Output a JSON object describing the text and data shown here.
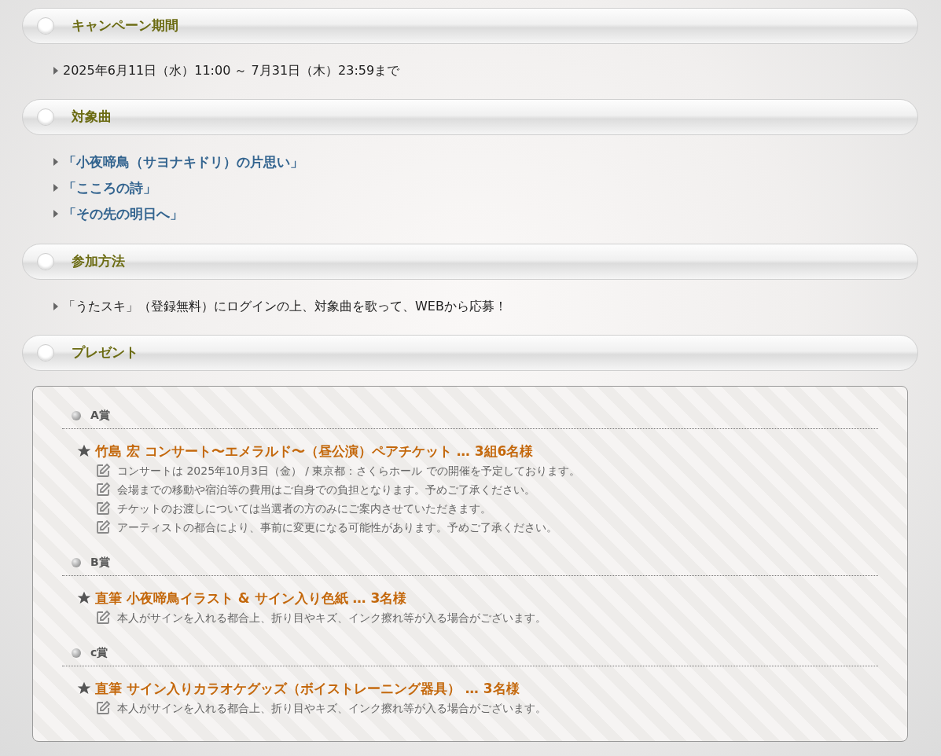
{
  "sections": [
    {
      "heading": "キャンペーン期間",
      "items": [
        {
          "kind": "text",
          "text": "2025年6月11日（水）11:00 ～ 7月31日（木）23:59まで"
        }
      ]
    },
    {
      "heading": "対象曲",
      "items": [
        {
          "kind": "link",
          "text": "「小夜啼鳥（サヨナキドリ）の片思い」"
        },
        {
          "kind": "link",
          "text": "「こころの詩」"
        },
        {
          "kind": "link",
          "text": "「その先の明日へ」"
        }
      ]
    },
    {
      "heading": "参加方法",
      "items": [
        {
          "kind": "text",
          "text": "「うたスキ」（登録無料）にログインの上、対象曲を歌って、WEBから応募！"
        }
      ]
    },
    {
      "heading": "プレゼント",
      "prizes": [
        {
          "label": "A賞",
          "title": "竹島 宏 コンサート〜エメラルド〜（昼公演）ペアチケット … 3組6名様",
          "notes": [
            "コンサートは 2025年10月3日（金） / 東京都：さくらホール での開催を予定しております。",
            "会場までの移動や宿泊等の費用はご自身での負担となります。予めご了承ください。",
            "チケットのお渡しについては当選者の方のみにご案内させていただきます。",
            "アーティストの都合により、事前に変更になる可能性があります。予めご了承ください。"
          ]
        },
        {
          "label": "B賞",
          "title": "直筆 小夜啼鳥イラスト & サイン入り色紙 … 3名様",
          "notes": [
            "本人がサインを入れる都合上、折り目やキズ、インク擦れ等が入る場合がございます。"
          ]
        },
        {
          "label": "c賞",
          "title": "直筆 サイン入りカラオケグッズ（ボイストレーニング器具） … 3名様",
          "notes": [
            "本人がサインを入れる都合上、折り目やキズ、インク擦れ等が入る場合がございます。"
          ]
        }
      ]
    }
  ]
}
